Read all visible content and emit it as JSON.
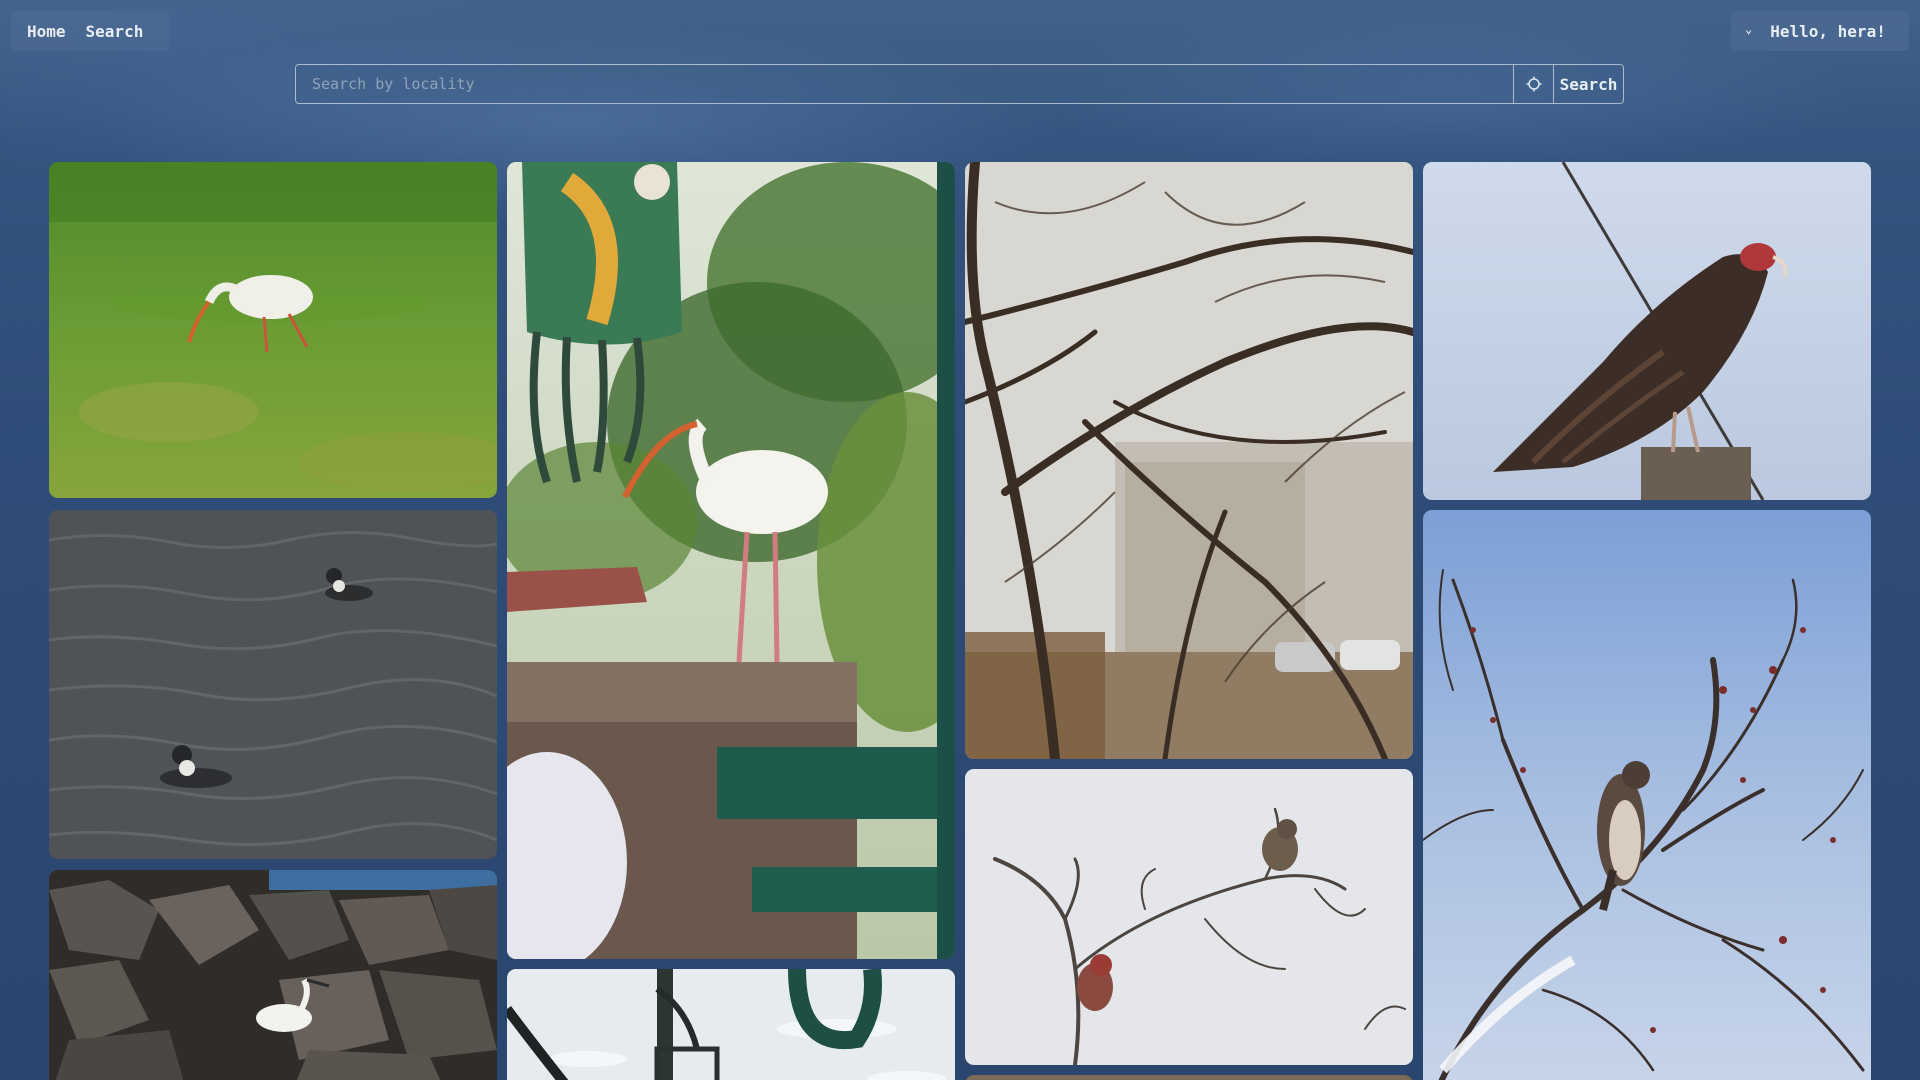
{
  "nav": {
    "home_label": "Home",
    "search_label": "Search"
  },
  "user": {
    "greeting": "Hello, hera!",
    "menu_icon": "chevron-down-icon"
  },
  "search": {
    "placeholder": "Search by locality",
    "value": "",
    "locate_icon": "location-target-icon",
    "button_label": "Search"
  },
  "gallery": {
    "photos": [
      {
        "subject": "white-ibis-on-grass"
      },
      {
        "subject": "loons-on-water"
      },
      {
        "subject": "egret-on-rocks"
      },
      {
        "subject": "white-ibis-on-wall"
      },
      {
        "subject": "bird-feeder-in-snow"
      },
      {
        "subject": "bare-tree-branches"
      },
      {
        "subject": "finches-on-branch"
      },
      {
        "subject": "turkey-vulture-on-post"
      },
      {
        "subject": "hawk-in-tree"
      }
    ]
  }
}
